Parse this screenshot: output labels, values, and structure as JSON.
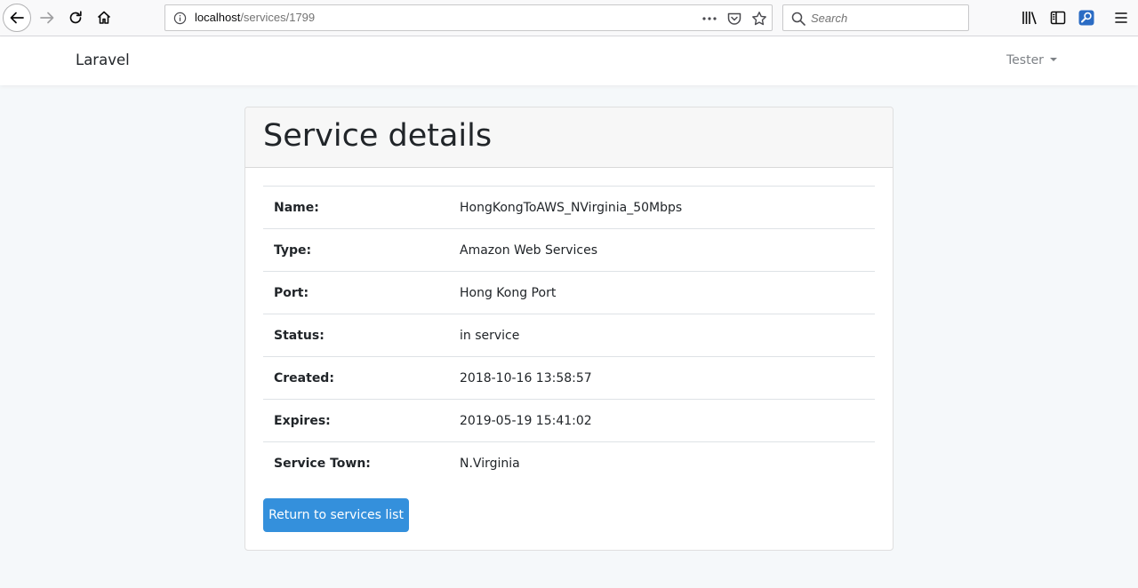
{
  "browser": {
    "url_host": "localhost",
    "url_path": "/services/1799",
    "search_placeholder": "Search",
    "icons": [
      "back-icon",
      "forward-icon",
      "reload-icon",
      "home-icon",
      "info-icon",
      "more-icon",
      "pocket-icon",
      "star-icon",
      "search-icon",
      "library-icon",
      "sidebar-icon",
      "extension-icon",
      "menu-icon"
    ]
  },
  "navbar": {
    "brand": "Laravel",
    "user": "Tester"
  },
  "card": {
    "title": "Service details",
    "rows": [
      {
        "label": "Name:",
        "value": "HongKongToAWS_NVirginia_50Mbps"
      },
      {
        "label": "Type:",
        "value": "Amazon Web Services"
      },
      {
        "label": "Port:",
        "value": "Hong Kong Port"
      },
      {
        "label": "Status:",
        "value": "in service"
      },
      {
        "label": "Created:",
        "value": "2018-10-16 13:58:57"
      },
      {
        "label": "Expires:",
        "value": "2019-05-19 15:41:02"
      },
      {
        "label": "Service Town:",
        "value": "N.Virginia"
      }
    ],
    "back_button": "Return to services list"
  },
  "colors": {
    "primary": "#3490dc",
    "page_background": "#f5f8fa"
  }
}
